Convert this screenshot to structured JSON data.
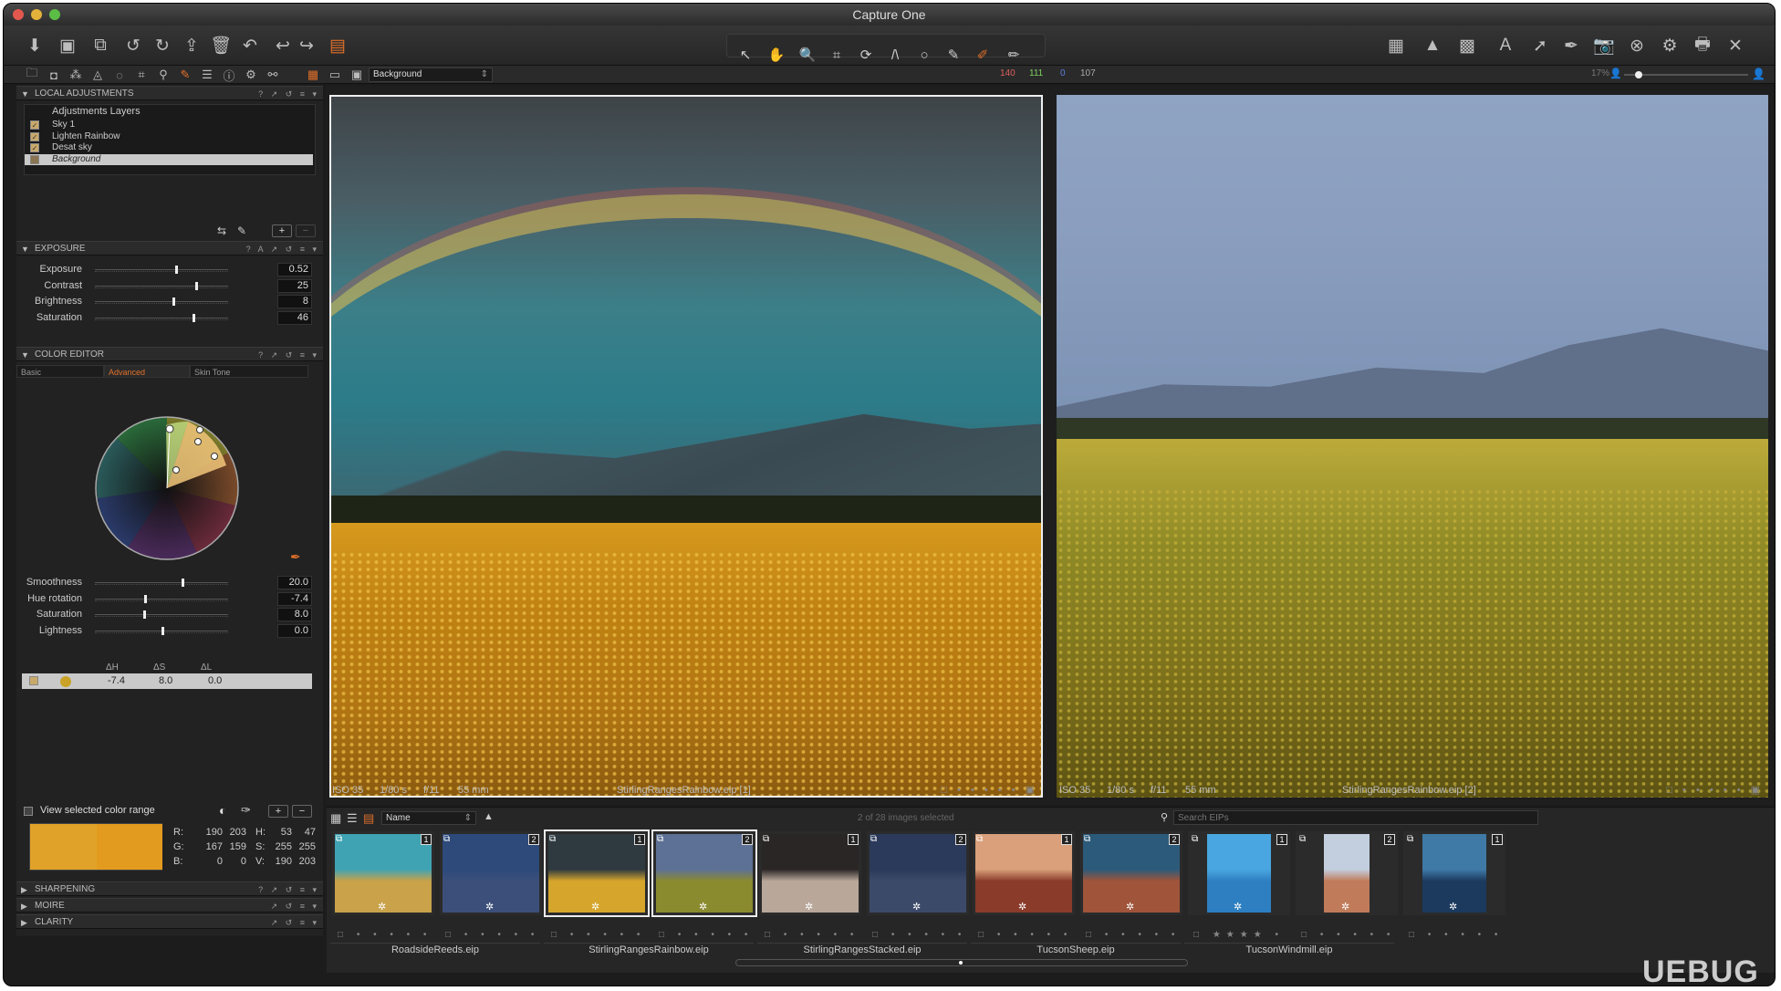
{
  "window": {
    "title": "Capture One"
  },
  "toolbar": {
    "left_icons": [
      "import-icon",
      "capture-icon",
      "editor-icon",
      "rotate-left-icon",
      "rotate-right-icon",
      "move-icon",
      "trash-icon",
      "undo-all-icon",
      "undo-icon",
      "redo-icon",
      "stack-icon"
    ],
    "center_tools": [
      "select",
      "pan",
      "zoom",
      "crop",
      "rotate",
      "straighten",
      "spot",
      "picker",
      "brush",
      "eraser"
    ],
    "right_icons": [
      "grid",
      "warning",
      "proof",
      "text",
      "arrow",
      "pen",
      "camera",
      "cancel",
      "settings",
      "print",
      "tools"
    ]
  },
  "viewer_bar": {
    "variant_select": "Background",
    "readout": {
      "r": "140",
      "g": "111",
      "b": "0",
      "l": "107"
    },
    "zoom": "17%"
  },
  "local_adjustments": {
    "title": "LOCAL ADJUSTMENTS",
    "header": "Adjustments Layers",
    "layers": [
      {
        "label": "Sky 1",
        "checked": true
      },
      {
        "label": "Lighten Rainbow",
        "checked": true
      },
      {
        "label": "Desat sky",
        "checked": true
      },
      {
        "label": "Background",
        "checked": false,
        "selected": true
      }
    ]
  },
  "exposure": {
    "title": "EXPOSURE",
    "sliders": [
      {
        "label": "Exposure",
        "value": "0.52",
        "pos": 0.6
      },
      {
        "label": "Contrast",
        "value": "25",
        "pos": 0.75
      },
      {
        "label": "Brightness",
        "value": "8",
        "pos": 0.58
      },
      {
        "label": "Saturation",
        "value": "46",
        "pos": 0.73
      }
    ]
  },
  "color_editor": {
    "title": "COLOR EDITOR",
    "tabs": [
      "Basic",
      "Advanced",
      "Skin Tone"
    ],
    "active_tab": "Advanced",
    "sliders": [
      {
        "label": "Smoothness",
        "value": "20.0",
        "pos": 0.65
      },
      {
        "label": "Hue rotation",
        "value": "-7.4",
        "pos": 0.37
      },
      {
        "label": "Saturation",
        "value": "8.0",
        "pos": 0.36
      },
      {
        "label": "Lightness",
        "value": "0.0",
        "pos": 0.5
      }
    ],
    "delta_headers": [
      "ΔH",
      "ΔS",
      "ΔL"
    ],
    "delta_values": [
      "-7.4",
      "8.0",
      "0.0"
    ],
    "view_range_label": "View selected color range",
    "readout": {
      "r1": "R:",
      "r2": "190",
      "r3": "203",
      "r4": "H:",
      "r5": "53",
      "r6": "47",
      "g1": "G:",
      "g2": "167",
      "g3": "159",
      "g4": "S:",
      "g5": "255",
      "g6": "255",
      "b1": "B:",
      "b2": "0",
      "b3": "0",
      "b4": "V:",
      "b5": "190",
      "b6": "203"
    },
    "swatch_colors": [
      "#e0a229",
      "#e39b1f"
    ]
  },
  "collapsed_sections": [
    "SHARPENING",
    "MOIRE",
    "CLARITY"
  ],
  "viewer": {
    "left_caption": {
      "iso": "ISO 35",
      "shutter": "1/80 s",
      "aperture": "f/11",
      "focal": "55 mm",
      "name": "StirlingRangesRainbow.eip [1]"
    },
    "right_caption": {
      "iso": "ISO 35",
      "shutter": "1/80 s",
      "aperture": "f/11",
      "focal": "55 mm",
      "name": "StirlingRangesRainbow.eip [2]"
    }
  },
  "browser": {
    "sort": "Name",
    "status": "2 of 28 images selected",
    "search_placeholder": "Search EIPs",
    "thumbs": [
      {
        "badge": "1",
        "colors": [
          "#3fa3b3",
          "#c9a24a"
        ]
      },
      {
        "badge": "2",
        "colors": [
          "#2d4a7a",
          "#3b4f7a"
        ]
      },
      {
        "badge": "1",
        "colors": [
          "#2e3a40",
          "#d6a62c"
        ],
        "selected": true
      },
      {
        "badge": "2",
        "colors": [
          "#5d7196",
          "#8a8a2f"
        ],
        "selected": true
      },
      {
        "badge": "1",
        "colors": [
          "#2a2626",
          "#b9a79a"
        ]
      },
      {
        "badge": "2",
        "colors": [
          "#2b3a5a",
          "#3c4a6a"
        ]
      },
      {
        "badge": "1",
        "colors": [
          "#d9a07b",
          "#8a3b2a"
        ]
      },
      {
        "badge": "2",
        "colors": [
          "#2c5a7a",
          "#a0543a"
        ]
      },
      {
        "badge": "1",
        "colors": [
          "#4aa6e0",
          "#2d7fc1"
        ]
      },
      {
        "badge": "2",
        "colors": [
          "#c3cfdf",
          "#c07b5a"
        ]
      },
      {
        "badge": "1",
        "colors": [
          "#3f7aa7",
          "#1b3a5e"
        ]
      }
    ],
    "groups": [
      "RoadsideReeds.eip",
      "StirlingRangesRainbow.eip",
      "StirlingRangesStacked.eip",
      "TucsonSheep.eip",
      "TucsonWindmill.eip"
    ]
  },
  "watermark": "UEBUG"
}
